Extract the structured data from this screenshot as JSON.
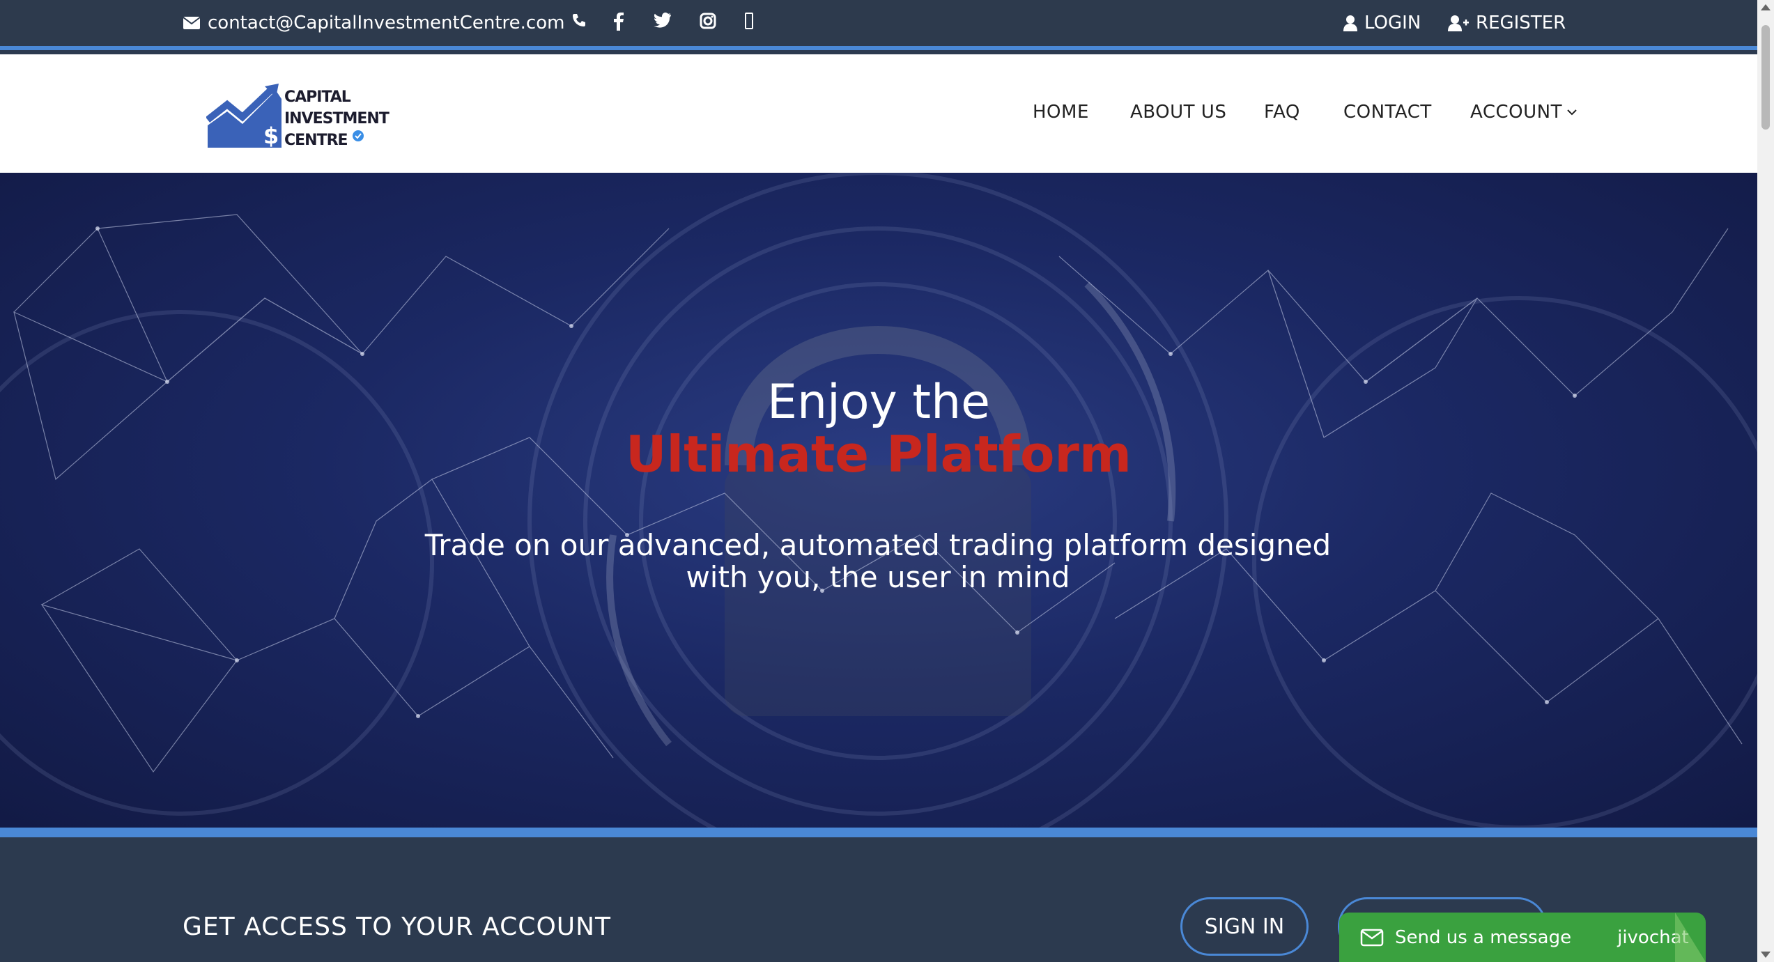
{
  "topbar": {
    "email": "contact@CapitalInvestmentCentre.com",
    "icons": [
      "envelope-icon",
      "phone-icon",
      "facebook-icon",
      "twitter-icon",
      "instagram-icon",
      "mobile-icon"
    ],
    "login_label": "LOGIN",
    "register_label": "REGISTER"
  },
  "logo": {
    "line1": "CAPITAL",
    "line2": "INVESTMENT",
    "line3": "CENTRE"
  },
  "nav": {
    "items": [
      {
        "label": "HOME"
      },
      {
        "label": "ABOUT US"
      },
      {
        "label": "FAQ"
      },
      {
        "label": "CONTACT"
      },
      {
        "label": "ACCOUNT"
      }
    ]
  },
  "hero": {
    "title_line1": "Enjoy the",
    "title_line2": "Ultimate Platform",
    "subtitle_line1": "Trade on our advanced, automated trading platform designed",
    "subtitle_line2": "with you, the user in mind"
  },
  "access": {
    "title": "GET ACCESS TO YOUR ACCOUNT",
    "signin_label": "SIGN IN"
  },
  "chat": {
    "label": "Send us a message",
    "brand": "jivochat"
  },
  "colors": {
    "topbar_bg": "#2d3a4d",
    "accent_blue": "#4a88d6",
    "hero_red": "#c8271e",
    "chat_green": "#3aa13f"
  }
}
